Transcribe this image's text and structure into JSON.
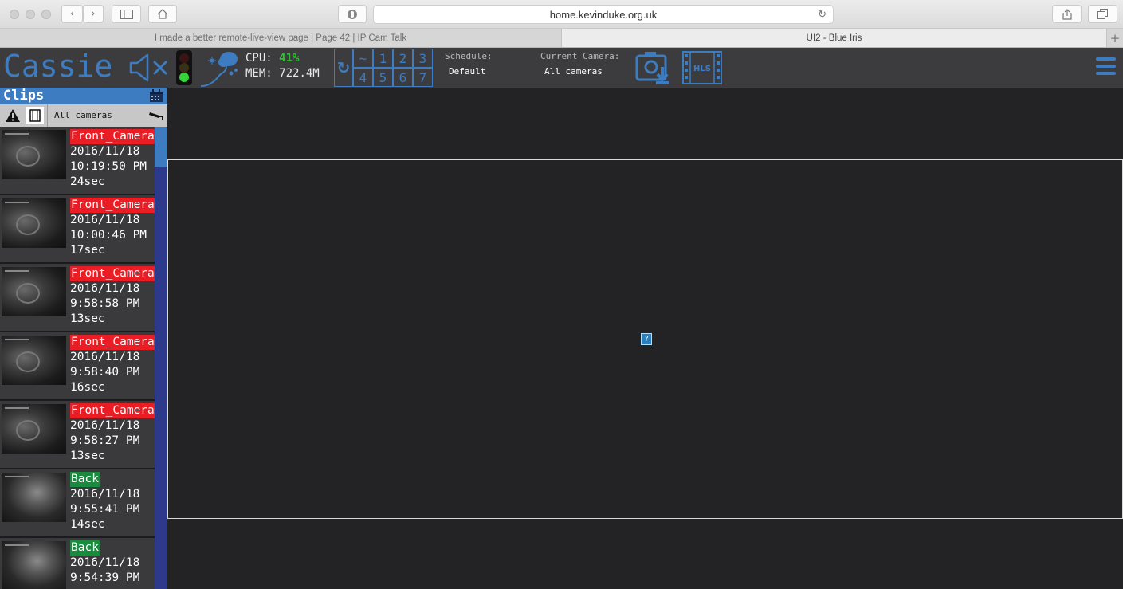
{
  "browser": {
    "url": "home.kevinduke.org.uk",
    "tabs": [
      {
        "title": "I made a better remote-live-view page | Page 42 | IP Cam Talk",
        "active": false
      },
      {
        "title": "UI2 - Blue Iris",
        "active": true
      }
    ]
  },
  "header": {
    "brand": "Cassie",
    "cpu_label": "CPU:",
    "cpu_value": "41%",
    "mem_label": "MEM:",
    "mem_value": "722.4M",
    "group_buttons": [
      "~",
      "1",
      "2",
      "3",
      "4",
      "5",
      "6",
      "7"
    ],
    "schedule_label": "Schedule:",
    "schedule_value": "Default",
    "camera_label": "Current Camera:",
    "camera_value": "All cameras",
    "hls_label": "HLS",
    "colors": {
      "accent": "#3d7cc0",
      "cpu_ok": "#28c428",
      "light_green": "#35d435"
    }
  },
  "sidebar": {
    "title": "Clips",
    "filter_label": "All cameras",
    "clips": [
      {
        "camera": "Front_Camera",
        "date": "2016/11/18",
        "time": "10:19:50 PM",
        "duration": "24sec"
      },
      {
        "camera": "Front_Camera",
        "date": "2016/11/18",
        "time": "10:00:46 PM",
        "duration": "17sec"
      },
      {
        "camera": "Front_Camera",
        "date": "2016/11/18",
        "time": "9:58:58 PM",
        "duration": "13sec"
      },
      {
        "camera": "Front_Camera",
        "date": "2016/11/18",
        "time": "9:58:40 PM",
        "duration": "16sec"
      },
      {
        "camera": "Front_Camera",
        "date": "2016/11/18",
        "time": "9:58:27 PM",
        "duration": "13sec"
      },
      {
        "camera": "Back",
        "date": "2016/11/18",
        "time": "9:55:41 PM",
        "duration": "14sec"
      },
      {
        "camera": "Back",
        "date": "2016/11/18",
        "time": "9:54:39 PM",
        "duration": ""
      }
    ],
    "camera_colors": {
      "Front_Camera": "#ea1c24",
      "Back": "#1a8a3e"
    }
  },
  "main": {
    "broken_image_glyph": "?"
  }
}
